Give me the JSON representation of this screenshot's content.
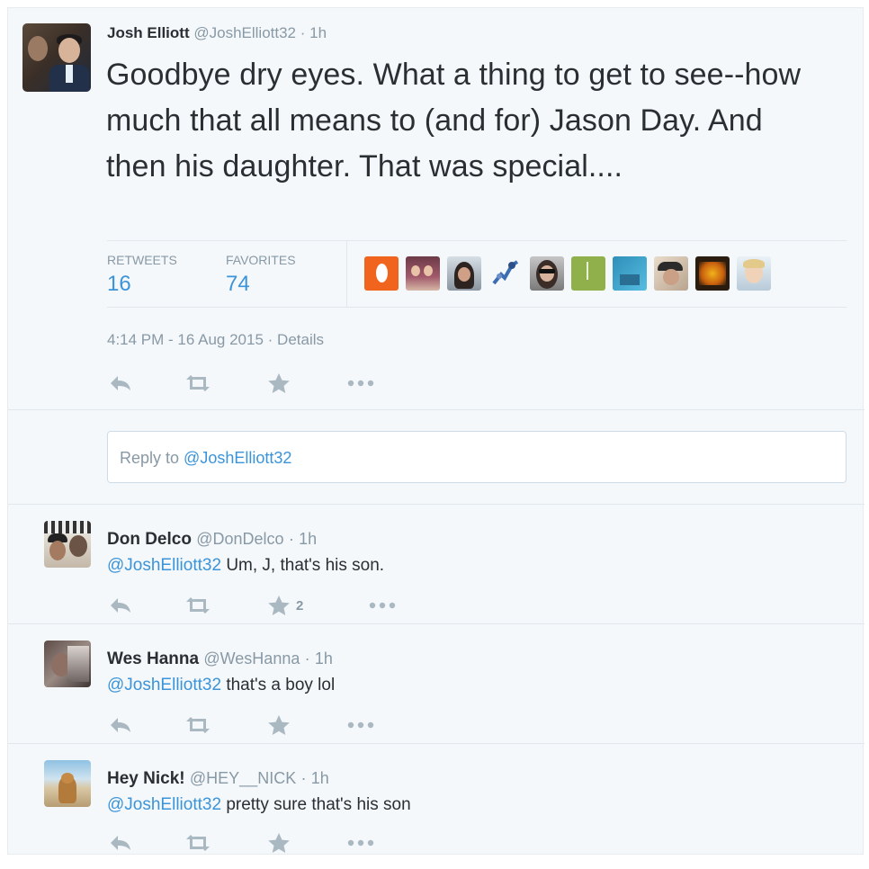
{
  "tweet": {
    "author_name": "Josh Elliott",
    "author_handle": "@JoshElliott32",
    "time_ago": "1h",
    "text": "Goodbye dry eyes. What a thing to get to see--how much that all means to (and for) Jason Day. And then his daughter. That was special....",
    "retweets_label": "RETWEETS",
    "retweets_count": "16",
    "favorites_label": "FAVORITES",
    "favorites_count": "74",
    "timestamp": "4:14 PM - 16 Aug 2015",
    "details_label": "Details"
  },
  "reply_box": {
    "prefix": "Reply to ",
    "mention": "@JoshElliott32"
  },
  "replies": [
    {
      "name": "Don Delco",
      "handle": "@DonDelco",
      "time_ago": "1h",
      "mention": "@JoshElliott32",
      "text": "Um, J, that's his son.",
      "favorite_count": "2"
    },
    {
      "name": "Wes Hanna",
      "handle": "@WesHanna",
      "time_ago": "1h",
      "mention": "@JoshElliott32",
      "text": "that's a boy lol",
      "favorite_count": ""
    },
    {
      "name": "Hey Nick!",
      "handle": "@HEY__NICK",
      "time_ago": "1h",
      "mention": "@JoshElliott32",
      "text": "pretty sure that's his son",
      "favorite_count": ""
    }
  ],
  "separator": "·",
  "icons": {
    "reply": "reply-icon",
    "retweet": "retweet-icon",
    "favorite": "star-icon",
    "more": "more-icon"
  },
  "colors": {
    "link": "#3b94d9",
    "muted": "#8899a6",
    "icon": "#aab8c2",
    "background": "#f5f8fa"
  }
}
